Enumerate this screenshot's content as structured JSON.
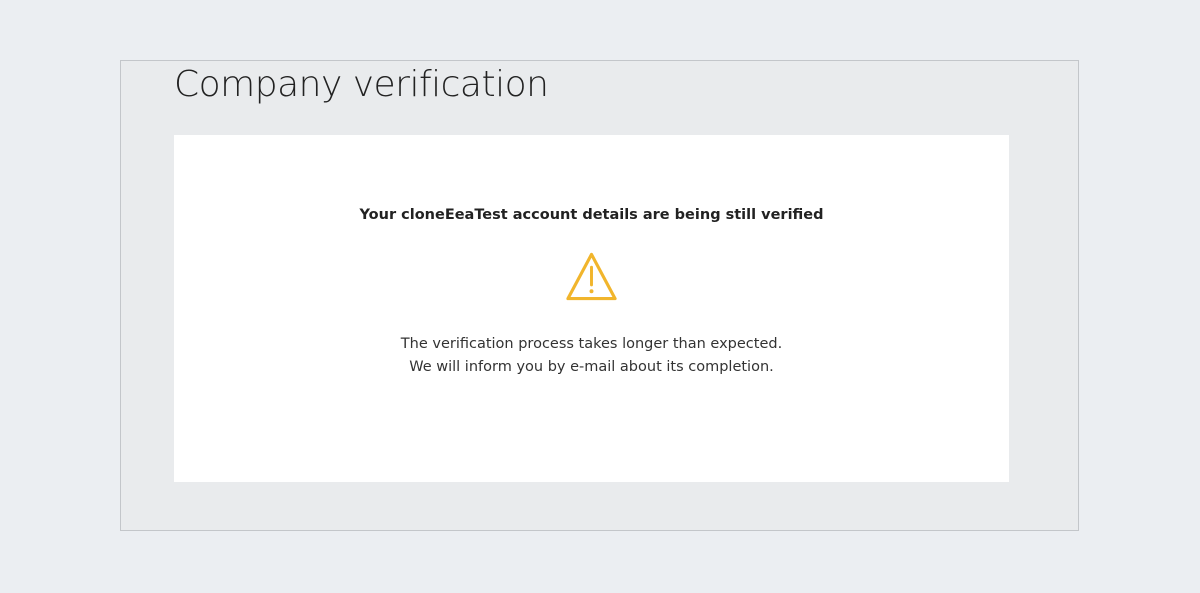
{
  "page": {
    "title": "Company verification"
  },
  "card": {
    "heading": "Your cloneEeaTest account details are being still verified",
    "icon": "warning-triangle-icon",
    "icon_color": "#f1b52c",
    "message_lines": [
      "The verification process takes longer than expected.",
      "We will inform you by e-mail about its completion."
    ]
  },
  "colors": {
    "page_background": "#ebeef2",
    "frame_background": "#e9ebed",
    "card_background": "#ffffff",
    "text": "#222222"
  }
}
